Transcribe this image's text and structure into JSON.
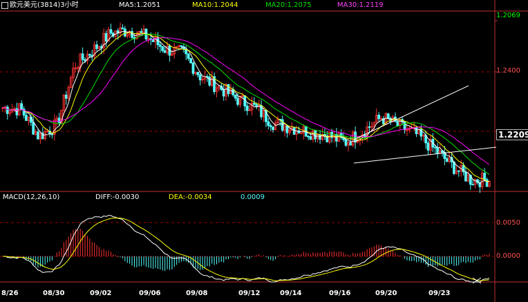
{
  "header": {
    "instrument": "欧元美元(3814)3小时",
    "ma5": "MA5:1.2051",
    "ma10": "MA10:1.2044",
    "ma20": "MA20:1.2075",
    "ma30": "MA30:1.2119"
  },
  "macd_header": {
    "name": "MACD(12,26,10)",
    "diff": "DIFF:-0.0030",
    "dea": "DEA:-0.0034",
    "macd": "0.0009"
  },
  "price_axis": {
    "top_label": "1.2069",
    "mid_label": "1.2400",
    "current_label": "1.2209"
  },
  "macd_axis": {
    "top_label": "0.0050",
    "zero_label": "0.0000"
  },
  "dates": [
    "8/26",
    "08/30",
    "09/02",
    "09/06",
    "09/08",
    "09/12",
    "09/14",
    "09/16",
    "09/20",
    "09/23"
  ],
  "colors": {
    "up_candle": "#ff3232",
    "down_candle": "#54ffff",
    "ma5": "#ffffff",
    "ma10": "#ffff00",
    "ma20": "#00e000",
    "ma30": "#ff00ff",
    "grid": "#a00000"
  },
  "chart_data": [
    {
      "type": "candlestick",
      "title": "欧元美元(3814)3小时",
      "y_ticks": [
        "1.2400",
        "1.2209",
        "1.2069"
      ],
      "x_tick_labels": [
        "8/26",
        "08/30",
        "09/02",
        "09/06",
        "09/08",
        "09/12",
        "09/14",
        "09/16",
        "09/20",
        "09/23"
      ],
      "close_anchors": [
        1.23,
        1.2295,
        1.2205,
        1.2243,
        1.244,
        1.249,
        1.2548,
        1.2556,
        1.2535,
        1.2495,
        1.248,
        1.2402,
        1.2368,
        1.233,
        1.23,
        1.225,
        1.2235,
        1.222,
        1.221,
        1.2185,
        1.2222,
        1.2268,
        1.224,
        1.221,
        1.216,
        1.2105,
        1.206,
        1.2062
      ],
      "series": [
        {
          "name": "MA5",
          "last": 1.2051
        },
        {
          "name": "MA10",
          "last": 1.2044
        },
        {
          "name": "MA20",
          "last": 1.2075
        },
        {
          "name": "MA30",
          "last": 1.2119
        }
      ]
    },
    {
      "type": "bar",
      "title": "MACD(12,26,10)",
      "y_ticks": [
        "0.0050",
        "0.0000"
      ],
      "series": [
        {
          "name": "DIFF",
          "last": -0.003
        },
        {
          "name": "DEA",
          "last": -0.0034
        },
        {
          "name": "MACD",
          "last": 0.0009
        }
      ]
    }
  ]
}
